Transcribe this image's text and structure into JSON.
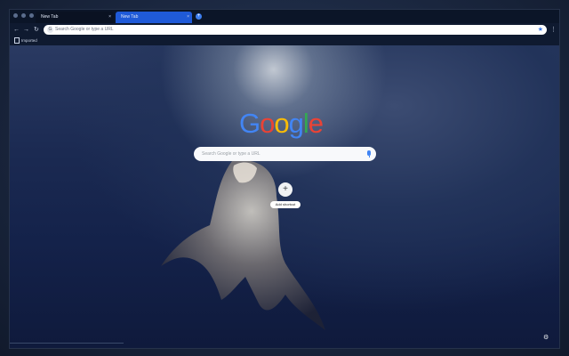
{
  "browser": {
    "tabs": [
      {
        "label": "New Tab",
        "close": "×"
      },
      {
        "label": "New Tab",
        "close": "×"
      }
    ],
    "new_tab_symbol": "+",
    "nav": {
      "back": "←",
      "forward": "→",
      "reload": "↻"
    },
    "omnibox": {
      "placeholder": "Search Google or type a URL",
      "g_glyph": "G",
      "star": "★"
    },
    "menu": "⋮",
    "bookmarks": [
      {
        "label": "Imported"
      }
    ]
  },
  "ntp": {
    "logo": {
      "letters": [
        "G",
        "o",
        "o",
        "g",
        "l",
        "e"
      ],
      "colors": [
        "#4285f4",
        "#ea4335",
        "#fbbc05",
        "#4285f4",
        "#34a853",
        "#ea4335"
      ]
    },
    "search_placeholder": "Search Google or type a URL",
    "add_shortcut": {
      "icon": "+",
      "label": "Add shortcut"
    },
    "customize_icon": "⚙"
  },
  "colors": {
    "tab_active": "#1f5ad8",
    "accent": "#3b78e7"
  }
}
